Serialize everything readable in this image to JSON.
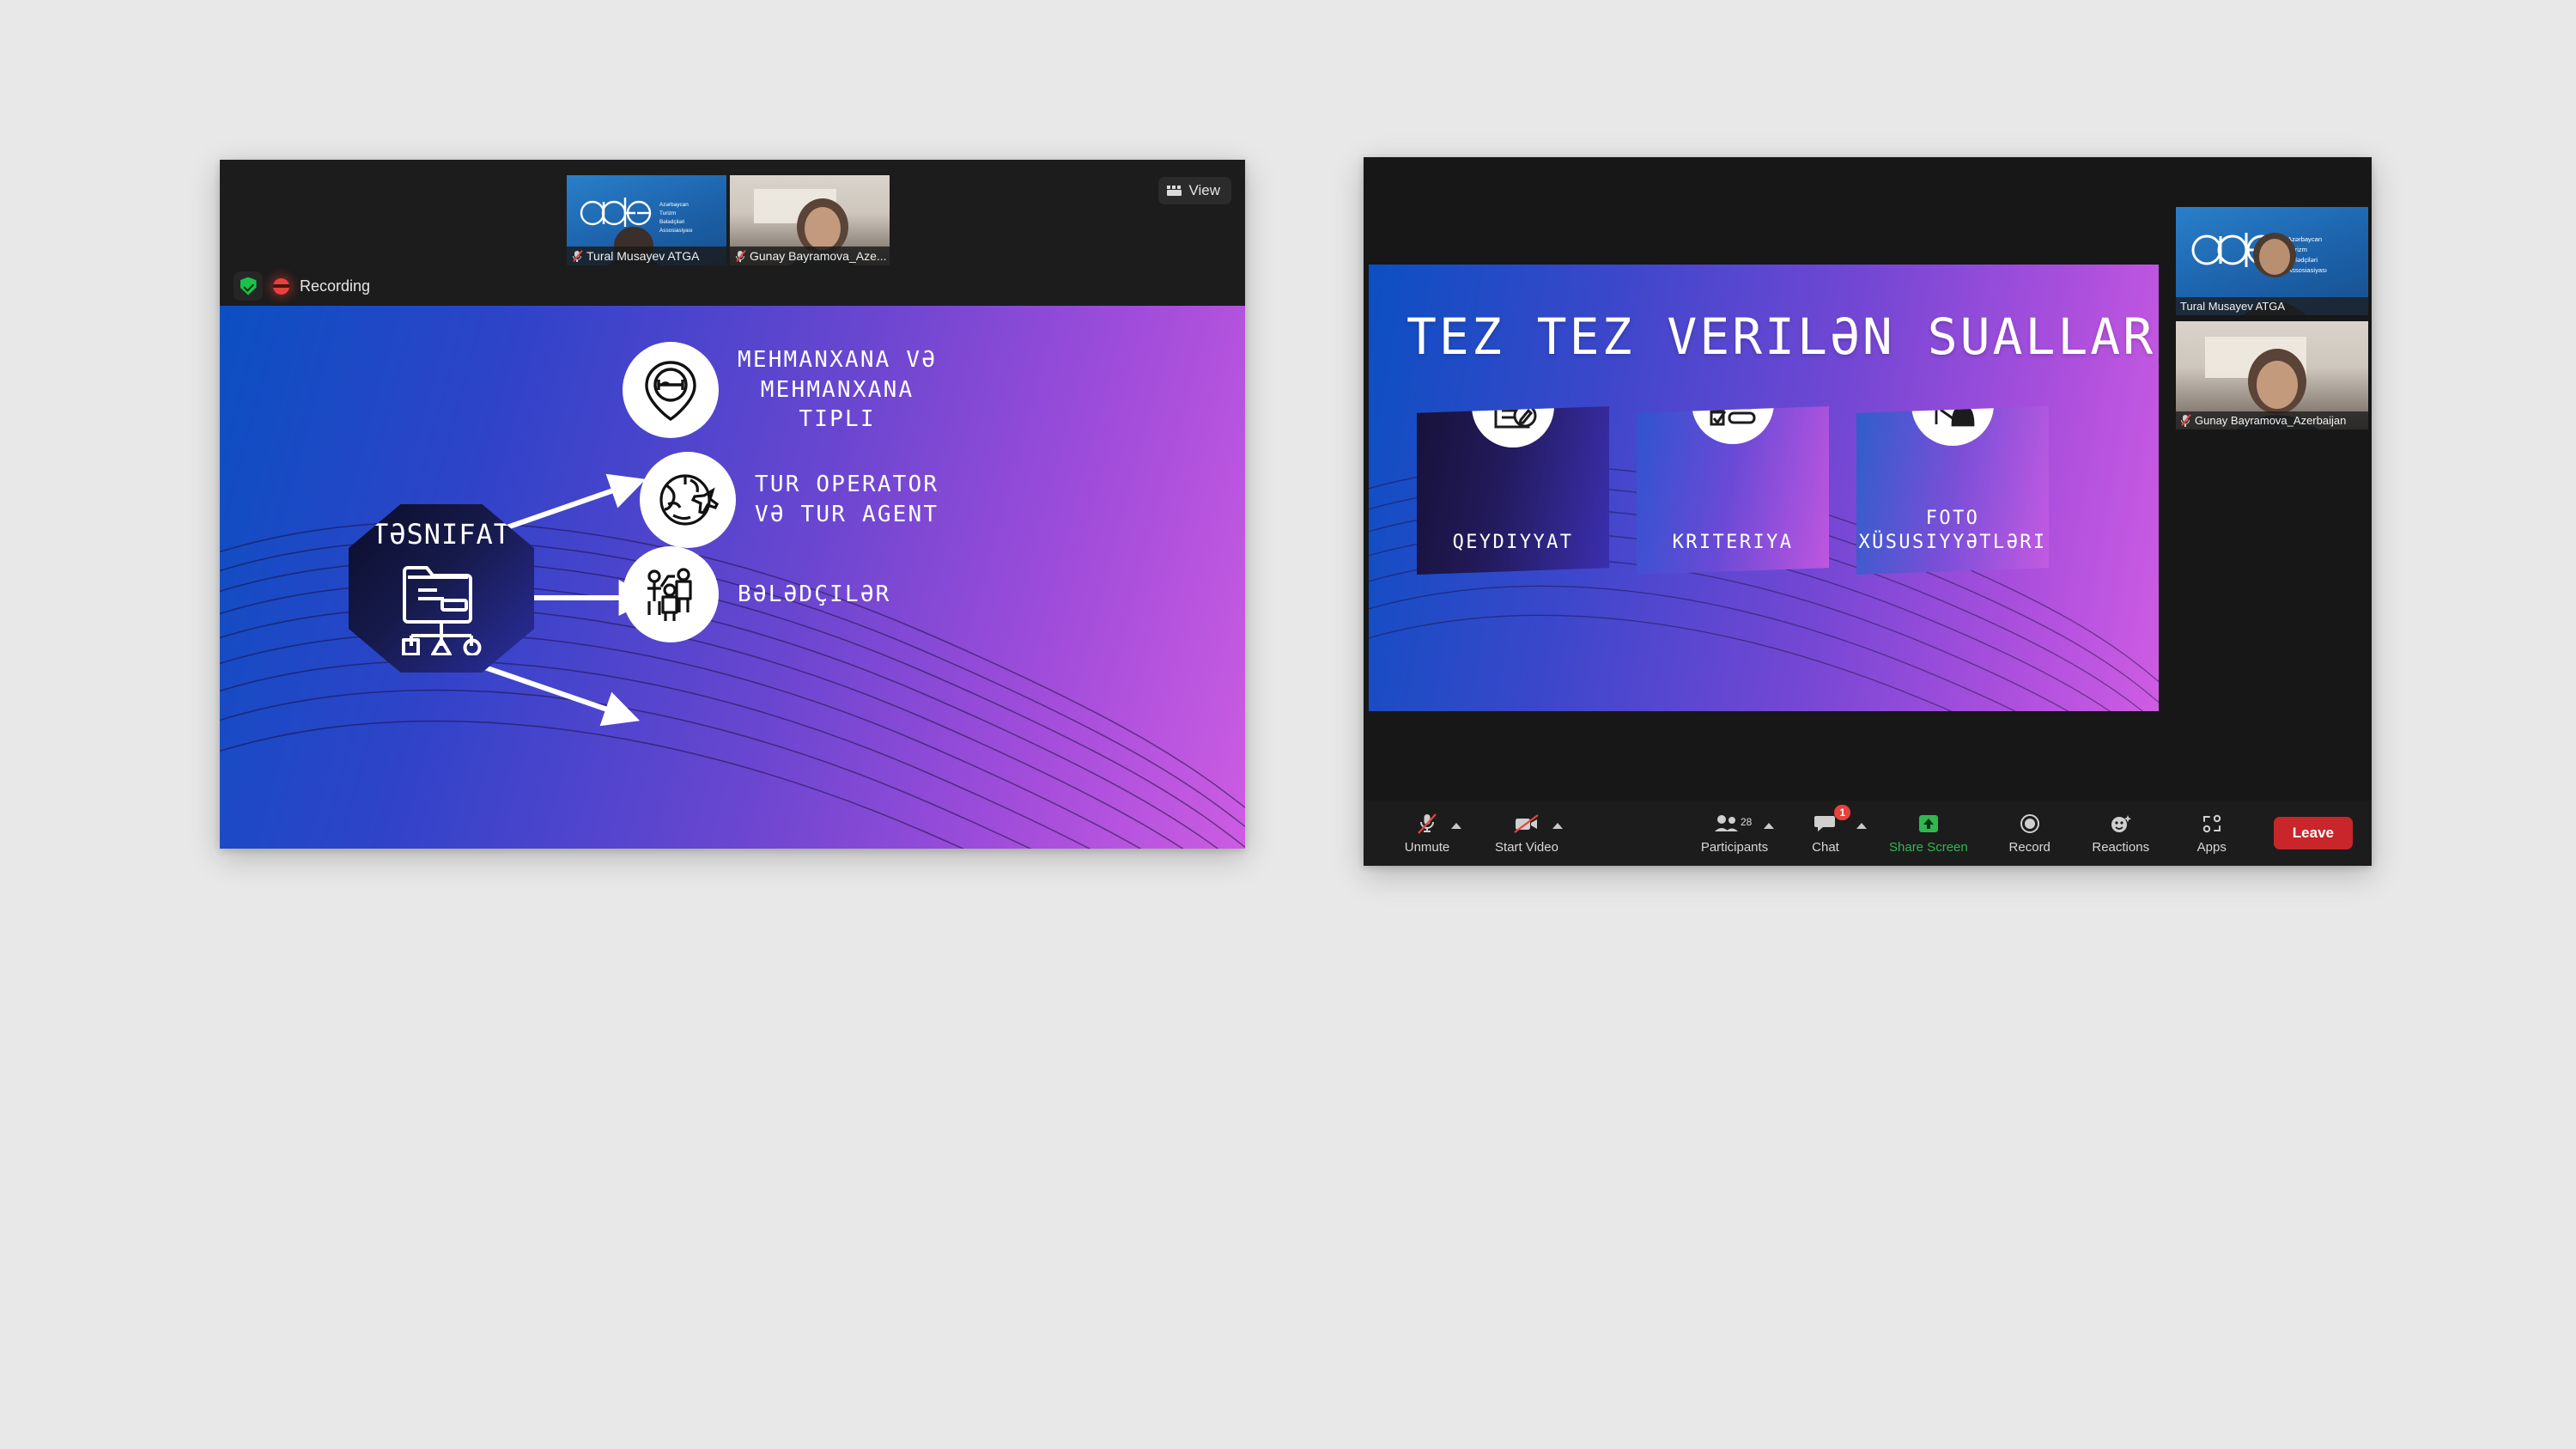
{
  "desktop": {
    "background": "#e8e8e8"
  },
  "left_window": {
    "view_button": {
      "label": "View",
      "icon": "grid-view-icon"
    },
    "recording": {
      "label": "Recording",
      "shield_icon": "security-shield-icon",
      "dot_icon": "recording-dot-icon"
    },
    "thumbnails": [
      {
        "name": "Tural Musayev ATGA",
        "muted": true,
        "background": "atga-logo-video"
      },
      {
        "name": "Gunay Bayramova_Aze...",
        "muted": true,
        "background": "webcam-video"
      }
    ],
    "slide": {
      "center_node": {
        "label": "TƏSNIFAT",
        "icon": "classification-folder-icon"
      },
      "branches": [
        {
          "label": "MEHMANXANA VƏ\nMEHMANXANA\nTIPLI",
          "icon": "hotel-pin-icon"
        },
        {
          "label": "TUR OPERATOR\nVƏ TUR AGENT",
          "icon": "globe-airplane-icon"
        },
        {
          "label": "BƏLƏDÇILƏR",
          "icon": "tour-guide-icon"
        }
      ],
      "arrow_count": 3,
      "gradient": [
        "#0b4fc2",
        "#6a46d0",
        "#cd5ce2"
      ]
    }
  },
  "right_window": {
    "slide": {
      "title": "TEZ TEZ VERILƏN SUALLAR",
      "cards": [
        {
          "label": "QEYDIYYAT",
          "icon": "document-pencil-icon",
          "color": "#17123a"
        },
        {
          "label": "KRITERIYA",
          "icon": "checklist-icon",
          "color": "#3a54c9"
        },
        {
          "label": "FOTO\nXÜSUSIYYƏTLƏRI",
          "icon": "presenter-board-icon",
          "color": "#2f5ecb"
        }
      ],
      "gradient": [
        "#0b4fc2",
        "#7447d4",
        "#cf5ce3"
      ]
    },
    "participant_rail": [
      {
        "name": "Tural Musayev ATGA",
        "active_speaker": true,
        "muted": false,
        "background": "atga-logo-video"
      },
      {
        "name": "Gunay Bayramova_Azerbaijan",
        "active_speaker": false,
        "muted": true,
        "background": "webcam-video"
      }
    ],
    "toolbar": {
      "items": [
        {
          "label": "Unmute",
          "icon": "microphone-muted-icon",
          "has_caret": true,
          "state": "muted"
        },
        {
          "label": "Start Video",
          "icon": "camera-off-icon",
          "has_caret": true,
          "state": "video-off"
        },
        {
          "label": "Participants",
          "icon": "participants-icon",
          "has_caret": true,
          "count": "28"
        },
        {
          "label": "Chat",
          "icon": "chat-bubble-icon",
          "has_caret": true,
          "badge": "1"
        },
        {
          "label": "Share Screen",
          "icon": "share-screen-up-arrow-icon",
          "accent": "#2fb84f"
        },
        {
          "label": "Record",
          "icon": "record-circle-icon"
        },
        {
          "label": "Reactions",
          "icon": "reactions-smiley-icon"
        },
        {
          "label": "Apps",
          "icon": "apps-bracket-icon"
        }
      ],
      "leave_button": {
        "label": "Leave",
        "color": "#c8262a"
      }
    }
  }
}
